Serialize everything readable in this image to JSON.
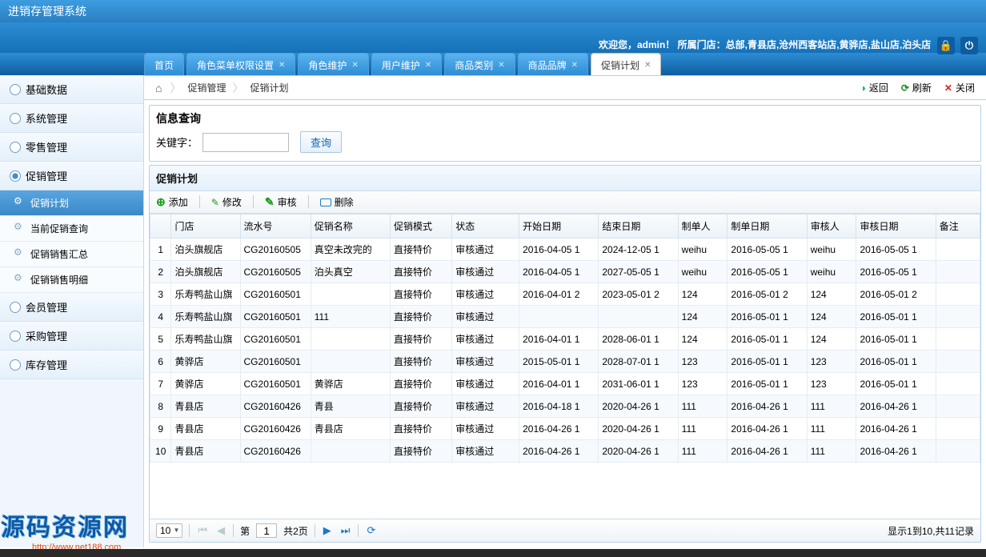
{
  "header": {
    "title": "进销存管理系统"
  },
  "welcome": {
    "prefix": "欢迎您，",
    "user": "admin！",
    "stores_label": " 所属门店：",
    "stores": "总部,青县店,沧州西客站店,黄骅店,盐山店,泊头店"
  },
  "tabs": [
    {
      "label": "首页",
      "closable": false
    },
    {
      "label": "角色菜单权限设置",
      "closable": true
    },
    {
      "label": "角色维护",
      "closable": true
    },
    {
      "label": "用户维护",
      "closable": true
    },
    {
      "label": "商品类别",
      "closable": true
    },
    {
      "label": "商品品牌",
      "closable": true
    },
    {
      "label": "促销计划",
      "closable": true,
      "active": true
    }
  ],
  "sidebar": {
    "items": [
      {
        "label": "基础数据"
      },
      {
        "label": "系统管理"
      },
      {
        "label": "零售管理"
      },
      {
        "label": "促销管理",
        "expanded": true,
        "subs": [
          {
            "label": "促销计划",
            "active": true
          },
          {
            "label": "当前促销查询"
          },
          {
            "label": "促销销售汇总"
          },
          {
            "label": "促销销售明细"
          }
        ]
      },
      {
        "label": "会员管理"
      },
      {
        "label": "采购管理"
      },
      {
        "label": "库存管理"
      }
    ]
  },
  "breadcrumb": {
    "items": [
      "促销管理",
      "促销计划"
    ],
    "back": "返回",
    "refresh": "刷新",
    "close": "关闭"
  },
  "query": {
    "title": "信息查询",
    "keyword_label": "关键字：",
    "search_btn": "查询",
    "keyword_value": ""
  },
  "grid": {
    "title": "促销计划",
    "toolbar": {
      "add": "添加",
      "edit": "修改",
      "audit": "审核",
      "del": "删除"
    },
    "cols": [
      "门店",
      "流水号",
      "促销名称",
      "促销模式",
      "状态",
      "开始日期",
      "结束日期",
      "制单人",
      "制单日期",
      "审核人",
      "审核日期",
      "备注"
    ],
    "rows": [
      [
        "1",
        "泊头旗舰店",
        "CG20160505",
        "真空未改完的",
        "直接特价",
        "审核通过",
        "2016-04-05 1",
        "2024-12-05 1",
        "weihu",
        "2016-05-05 1",
        "weihu",
        "2016-05-05 1",
        ""
      ],
      [
        "2",
        "泊头旗舰店",
        "CG20160505",
        "泊头真空",
        "直接特价",
        "审核通过",
        "2016-04-05 1",
        "2027-05-05 1",
        "weihu",
        "2016-05-05 1",
        "weihu",
        "2016-05-05 1",
        ""
      ],
      [
        "3",
        "乐寿鸭盐山旗",
        "CG20160501",
        "",
        "直接特价",
        "审核通过",
        "2016-04-01 2",
        "2023-05-01 2",
        "124",
        "2016-05-01 2",
        "124",
        "2016-05-01 2",
        ""
      ],
      [
        "4",
        "乐寿鸭盐山旗",
        "CG20160501",
        "111",
        "直接特价",
        "审核通过",
        "",
        "",
        "124",
        "2016-05-01 1",
        "124",
        "2016-05-01 1",
        ""
      ],
      [
        "5",
        "乐寿鸭盐山旗",
        "CG20160501",
        "",
        "直接特价",
        "审核通过",
        "2016-04-01 1",
        "2028-06-01 1",
        "124",
        "2016-05-01 1",
        "124",
        "2016-05-01 1",
        ""
      ],
      [
        "6",
        "黄骅店",
        "CG20160501",
        "",
        "直接特价",
        "审核通过",
        "2015-05-01 1",
        "2028-07-01 1",
        "123",
        "2016-05-01 1",
        "123",
        "2016-05-01 1",
        ""
      ],
      [
        "7",
        "黄骅店",
        "CG20160501",
        "黄骅店",
        "直接特价",
        "审核通过",
        "2016-04-01 1",
        "2031-06-01 1",
        "123",
        "2016-05-01 1",
        "123",
        "2016-05-01 1",
        ""
      ],
      [
        "8",
        "青县店",
        "CG20160426",
        "青县",
        "直接特价",
        "审核通过",
        "2016-04-18 1",
        "2020-04-26 1",
        "111",
        "2016-04-26 1",
        "111",
        "2016-04-26 1",
        ""
      ],
      [
        "9",
        "青县店",
        "CG20160426",
        "青县店",
        "直接特价",
        "审核通过",
        "2016-04-26 1",
        "2020-04-26 1",
        "111",
        "2016-04-26 1",
        "111",
        "2016-04-26 1",
        ""
      ],
      [
        "10",
        "青县店",
        "CG20160426",
        "",
        "直接特价",
        "审核通过",
        "2016-04-26 1",
        "2020-04-26 1",
        "111",
        "2016-04-26 1",
        "111",
        "2016-04-26 1",
        ""
      ]
    ],
    "pager": {
      "page_size": "10",
      "page_label_pre": "第",
      "page": "1",
      "page_label_post": " 共2页",
      "info": "显示1到10,共11记录"
    }
  },
  "watermark": {
    "text": "源码资源网",
    "url": "http://www.net188.com"
  }
}
